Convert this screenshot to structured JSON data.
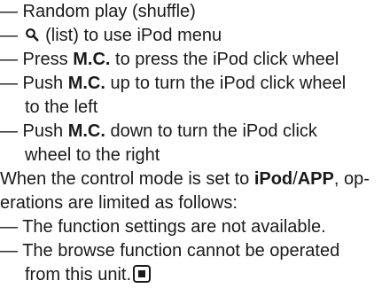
{
  "items": {
    "random_play": "— Random play (shuffle)",
    "list_dash": "— ",
    "list_rest": "(list) to use iPod menu",
    "mc_press_pre": "— Press ",
    "mc_label": "M.C.",
    "mc_press_post": " to press the iPod click wheel",
    "mc_up_pre": "— Push ",
    "mc_up_post": " up to turn the iPod click wheel",
    "mc_up_cont": "to the left",
    "mc_down_pre": "— Push ",
    "mc_down_post": " down to turn the iPod click",
    "mc_down_cont": "wheel to the right"
  },
  "paragraph": {
    "line1_pre": "When the control mode is set to ",
    "ipod": "iPod",
    "slash": "/",
    "app": "APP",
    "line1_post": ", op-",
    "line2": "erations are limited as follows:"
  },
  "limits": {
    "item1": "— The function settings are not available.",
    "item2": "— The browse function cannot be operated",
    "item2_cont": "from this unit."
  },
  "icons": {
    "list": "search-icon",
    "end": "stop-icon"
  }
}
